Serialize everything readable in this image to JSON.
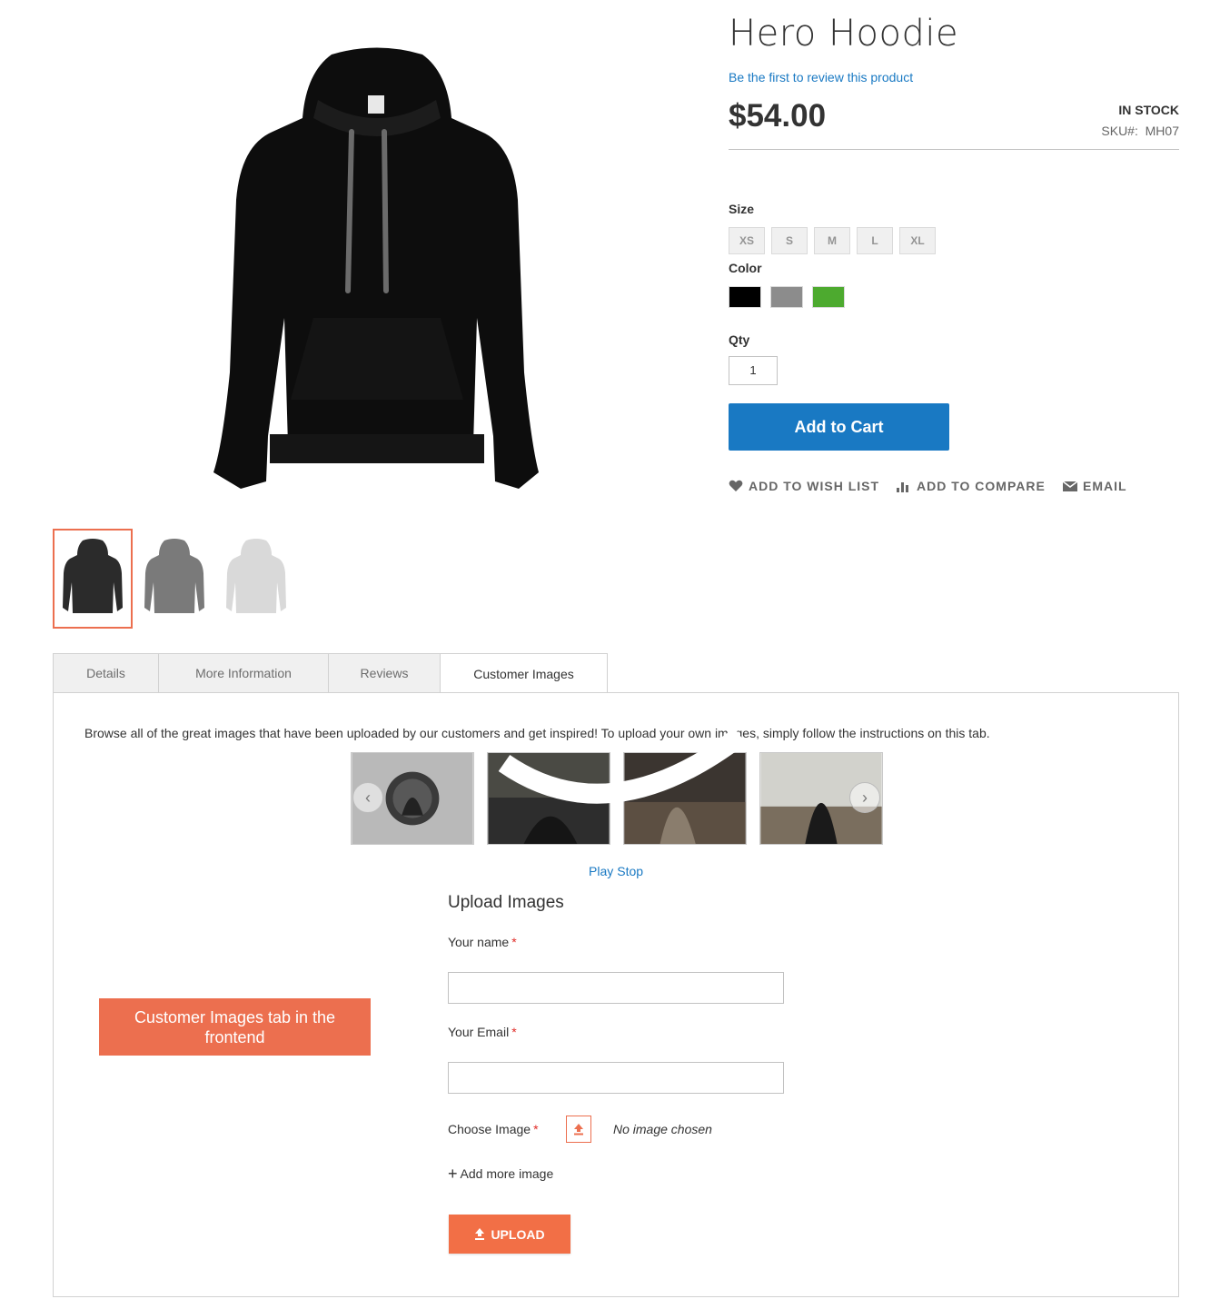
{
  "product": {
    "title": "Hero Hoodie",
    "review_link": "Be the first to review this product",
    "price": "$54.00",
    "stock": "IN STOCK",
    "sku_label": "SKU#:",
    "sku": "MH07"
  },
  "options": {
    "size_label": "Size",
    "sizes": [
      "XS",
      "S",
      "M",
      "L",
      "XL"
    ],
    "color_label": "Color",
    "colors": [
      "#000000",
      "#8c8c8c",
      "#4daa2f"
    ],
    "qty_label": "Qty",
    "qty_value": "1"
  },
  "actions": {
    "add_to_cart": "Add to Cart",
    "wish_list": "ADD TO WISH LIST",
    "compare": "ADD TO COMPARE",
    "email": "EMAIL"
  },
  "gallery": {
    "thumbnail_colors": [
      "#2b2b2b",
      "#7a7a7a",
      "#d9d9d9"
    ]
  },
  "tabs": [
    {
      "label": "Details",
      "active": false
    },
    {
      "label": "More Information",
      "active": false
    },
    {
      "label": "Reviews",
      "active": false
    },
    {
      "label": "Customer Images",
      "active": true
    }
  ],
  "customer_images": {
    "intro": "Browse all of the great images that have been uploaded by our customers and get inspired! To upload your own images, simply follow the instructions on this tab.",
    "play": "Play",
    "stop": "Stop",
    "upload_title": "Upload Images",
    "name_label": "Your name",
    "email_label": "Your Email",
    "choose_image_label": "Choose Image",
    "required_mark": "*",
    "no_image": "No image chosen",
    "add_more": "Add more image",
    "upload_button": "UPLOAD"
  },
  "callout": {
    "text": "Customer Images tab in the frontend"
  },
  "colors": {
    "accent_blue": "#1979c3",
    "accent_orange": "#ec6f4f"
  }
}
